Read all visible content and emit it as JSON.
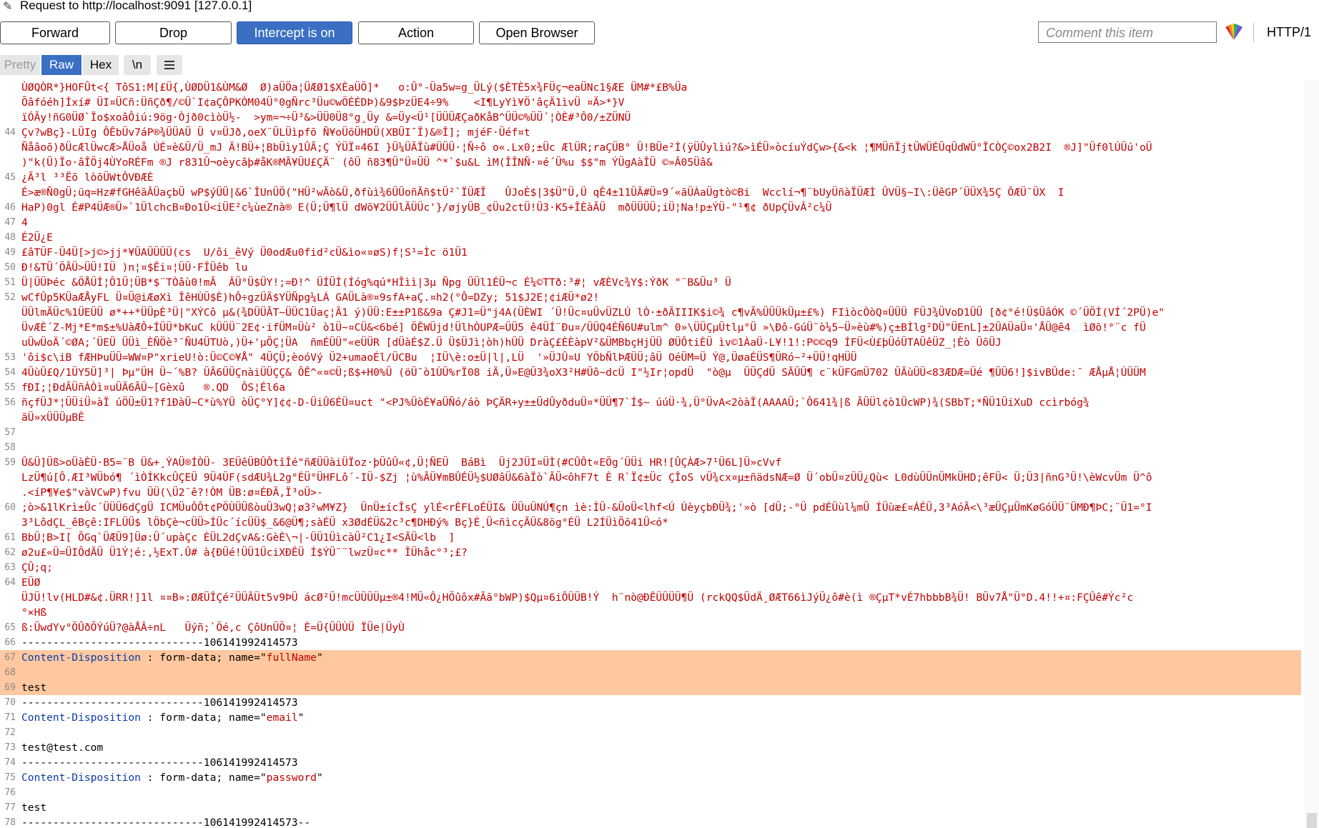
{
  "title": "Request to http://localhost:9091  [127.0.0.1]",
  "toolbar": {
    "forward": "Forward",
    "drop": "Drop",
    "intercept": "Intercept is on",
    "action": "Action",
    "open_browser": "Open Browser",
    "comment_placeholder": "Comment this item",
    "protocol": "HTTP/1",
    "active_color": "#3a6fc4"
  },
  "view": {
    "pretty": "Pretty",
    "raw": "Raw",
    "hex": "Hex",
    "newline": "\\n",
    "menu_icon": "hamburger-icon"
  },
  "body": {
    "lines": [
      {
        "n": "",
        "t": "ÙØQÒR*}HOFÛt<{ TôS1:M[£Ü{,ÙØDÜ1&ÙM&Ø  Ø)aÜÖa¦ÜÆØ1$XÈaÜÖ]*   o:Û°-Üa5w=g_ÜLý($ÈTÈ5x¾FÜç¬eaÜNc1§ÆE ÜM#*£B%Üa"
      },
      {
        "n": "",
        "t": "Õâfóéh]Íxí# ÜI¤ÜCñ:ÜñÇð¶/©Ü`I¢aÇÔPKÒM04Ü°0gÑrc³Üu©wÖÉÉDÞ)&9$ÞzÜE4÷9%    <I¶LyYì¥Ö'âçÄ1ìvÜ ¤Ä>*}V"
      },
      {
        "n": "",
        "t": "ïÓÃy!ñG0ÜØ`Ïo$xoâÔiú:9ög·Òjð0cìòÜ½-  >ym=¬÷Ü³&>ÜÜ0Ü8°g¸Üy &=Üy<Ü¹[ÜÜÜÆÇaðKåB^ÜÜ©%ÜÜ´¦ÒÈ#³Ô0/±ZÜNÜ"
      },
      {
        "n": "44",
        "t": "Çv?wBç}-LÜIg ÔÊbÜv7áP®¾ÜÜAÜ Ü v¤ÜJð,oeX¨ÜLÜìpfõ Ñ¥oÜõÜHDÜ(XBÜI¯Ï)&®Î]; mjéF·Üéf¤t"
      },
      {
        "n": "",
        "t": "Ñåâoõ)ðÜcÆlÜwcÆ>ÅÜoå ÚÉ¤è&Ü/Ü_mJ Ä!BÜ+¦BbÜìy1ÛÃ;Ç ÝÜÏ¤46I }Ü¼ÜÃÏù#ÜÜÜ·¦Ñ÷ô o«.Lx0;±Üc ÆlÜR;raÇÜB° Ü!BÜe²Ì(ÿÜÛylìú?&>ìÉÜ»òcíuÝdÇw>{&<k ¦¶MÜñÏjtÜWÜÉÜqÜdWÜ°ÏCÒÇ©ox2B2I  ®J]\"Üf0lÚÜú'oÜ"
      },
      {
        "n": "",
        "t": ")\"k(Ü)Ïo·âÎÖj4ÙYoRÉFm ®J r831Û¬oèycâþ#åK®MÃ¥ÜU£ÇÄ¨ (ôÜ ñ83¶Ü\"Ü¤ÜÜ ^*`$u&L ìM(ÎÎNÑ·¤é´Ü%u $$\"m ÝÜgAàÎÜ ©»Â05Üâ&"
      },
      {
        "n": "45",
        "t": "¿Ã³l ³³Ëõ lòõÜWtÔVÐÆÈ"
      },
      {
        "n": "",
        "t": "É>æ®Ñ0gÜ;üq=Hz#fGHêãÂÜaçbÜ wP$ýÜÜ|&6`ÎUnÜÖ(\"HÜ²wÃò&Ü,ðfùì¾6ÜÜoñÃñ$tÜ²`ÏÜÆÎ   ÛJoÈ$|3$Ü\"Ü,Ü qÊ4±11ÜÃ#Ü¤9´«ãÜÀaÜgtò©Bi  Wcclí¬¶¨bUyÜñàÏÜÆÌ ÛVÜ§~I\\:ÜêGP´ÜÜX¾5Ç ÔÆÜ¯ÜX  I"
      },
      {
        "n": "46",
        "t": "HaP)0gl É#P4ÜÆ®Ü»`1ÜlchcB¤Ðo1Ü<iÜE²c¼ùeZnà® E(Ü;Ü¶lÜ dWõ¥2ÜÜlÃÜÜc'}/øjyÜB_¢Üu2ctÜ!Ü3·K5+ÎÈàÃÜ  mðÜÜÜÜ;iÜ¦Na!p±ÝÜ-\"¹¶¢ ðUpÇÜvÂ²c¼Ü"
      },
      {
        "n": "47",
        "t": "4"
      },
      {
        "n": "48",
        "t": "É2Ü¿E"
      },
      {
        "n": "49",
        "t": "£âTÜF-Ü4Ü[>j©>jj*¥ÜAÜÜÜÜ(cs  U/ôi_êVý Ü0odÆu0fid²cÜ&ìo«¤øS)f¦S¹=Ìc ö1Ü1"
      },
      {
        "n": "50",
        "t": "Ð!&TÜ´ÖÃÜ>ÜÜ!IÜ )n¦¤$Êi¤¦ÜÜ·FÎÜêb lu"
      },
      {
        "n": "51",
        "t": "Ü|ÜÜÞéc &ÖÅÜÍ¦Ô1Ü¦ÜB*$¨TÒâù0!mÃ  ÂÜ°Ü$ÜY!;=Ð!^ ÜÍÜÍ(Íóg%qú*HÎìì|3µ Ñpg ÜÜl1ÉÜ¬c É¼©TTð:³#¦ vÆÈVc¾Y$:ÝðK \"¨B&Üu³ Ü"
      },
      {
        "n": "52",
        "t": "wCfÛp5KÜaÆÅyFL Ü¤Ü@iÆøXì ÎêHÙÜ$È)hÔ÷gzÜÄ$YÜÑpg¼LÁ GAÜLà®¤9sfA+aÇ.¤h2(°Ô=DZy; 51$J2E¦¢iÆÜ*ø2!"
      },
      {
        "n": "",
        "t": "ÜÜlmÃÜc%1ÜEÜÜ ø*++*ÜÜpÈ³Ü|\"XÝCô µ&(¾DÜÜÃT~ÜÜC1Üaç¦Ã1 ý)ÜÜ:E±±P1ß&9a Ç#J1=Ü\"j4A(ÜÈWI ´Ü!Üc¤uÜvÜZLÚ lÒ·±ðÃIIIK$i©¾ c¶vÃ%ÜÜÜkÜµ±£%) FIìòcÒòQ¤ÜÜÜ FÜJ¾ÜVoD1ÜÜ [ð¢°é!Ü$ÜâÓK ©´ÜÖÍ(VÍ´2PÜ)e\""
      },
      {
        "n": "",
        "t": "ÜvÆÈ´Z-Mj*E*m$±%UàÆÔ+ÍÜÜ*bKuC kÜÜÜ¨2E¢·ifÜM¤Üù² ò1Ü~¤CÜ&<6bé] ÖÊWÜjd!ÜlhÒUPÆ=ÜÜ5 ê4ÜÍ¨Ðu¤/ÜÜQ4ÉÑ6U#ulm^ 0»\\ÜÜÇµÜtlµ°Ü »\\Ðô-GúÜ¯ò¼5~Ü»èù#%)ç±BÌlg²DÜ\"ÜEnL]±2ÜAÜaÜ¤'ÅÜ@ê4  ìØõ!°¨c fÜ"
      },
      {
        "n": "",
        "t": "uÜwÜoÄ´©ØA;´ÜEÜ ÜÜì_ÈÑÖè³¯ÑU4ÜTUò,)Ü+'µÕÇ¦ÜA  ñmÉÜÜ\"«eÜÜR [dÜàÉ$Z.Ü Ü$ÜJì¦òh)hÜÜ DràÇ£ÈÈàpV²&ÜMBbçHjÜÜ ØÜÔtiÈÜ ìv©1ÀaÜ-L¥!1!:P©©q9 ÍFÜ<Ù£þÜóÜTAÜêÜZ_¦Èò ÜõÜJ"
      },
      {
        "n": "53",
        "t": "'ôi$c\\iB fÆHÞuÜÜ=WW¤P\"xrieU!ò:Ü©C©¥Å\" 4ÜÇÜ;èoóVý Ü2+umaoÉl/ÜCBu  ¦IÜ\\è:o±Ü|l|,LÜ  '»ÜJÛ¤U YÖbÑlÞÆÜÜ;âÜ OéÜM=Ü Ý@,ÜøaÉÜS¶ÜRó~²+ÜÜ!qHÜÜ"
      },
      {
        "n": "54",
        "t": "4ÜùÜ£Q/1ÜY5Ü]³| Þµ\"ÜH Ü~´%B? ÜÃ6ÜÜÇnàiÜÜÇÇ& ÔÊ^«¤©Ü;ß$+H0%Ü (öÜ¯ò1ÙÜ%rÏ08 iÃ,Ü»E@Ü3¾oX3²H#Üô~dcÜ I\"½Ir¦opdÜ  \"ò@µ  ÜÜÇdÜ SÃÜÜ¶ c¨kÜFGmÜ702 ÜÃùÜÜ<83ÆDÆ=Üé ¶ÜÜ6!]$ivBÜde:¯ ÆÅµÅ¦ÚÜÜM"
      },
      {
        "n": "55",
        "t": "fÐI;¦ÐdÃÜñÀÒì¤uÜÄ6ÃÜ~[Gèxû   ®.QD  ÔS¦Él6a"
      },
      {
        "n": "56",
        "t": "ñçfÜJ*¦ÜÜiÜ»àÏ úÖÜ±Ü1?f1ÐàÜ~C*ù%YÜ òÜÇ°Y]¢¢-D-ÜiÛ6ÉÜ¤uct \"<PJ%ÜòÉ¥aÜÑó/áò ÞÇÄR+y±±ÜdÛyðduÜ¤*ÜÜ¶7`Í$~ úúÜ·¾,Ü°ÜvA<2òàÏ(AAAAÜ;`Ô641¾|ß ÃÜÜl¢ò1ÜcWP)¾(SBbT;*ÑÜ1ÜiXuD ccìrbóg¾"
      },
      {
        "n": "",
        "t": "ãÜ»xÜÜÜµBÊ"
      },
      {
        "n": "57",
        "t": ""
      },
      {
        "n": "58",
        "t": ""
      },
      {
        "n": "59",
        "t": "Û&Ü]Üß>oÜàÈÜ·B5=¨B Ü&+¸ÝAÜ®ÍÒÜ- 3EÜêÜBÛÔtîÎé\"ñÆÜÜàiÜÏoz·þÜûÛ«¢,Ü¦ÑEÜ  BáBì  Üj2JÜI¤ÜÌ(#CÛÔt«EÕg´ÜÜi HR![ÛÇÀÆ>7¹Ü6L]Ü»cVvf"
      },
      {
        "n": "",
        "t": "LzÜ¶ú[Ô.ÆI³WÜbó¶ ´ìÒÍKkcÛÇEÜ 9Ü4ÜF(sdÆU¾L2g°ÉÜ°ÜHFLô´-IÜ-$Zj ¦ù%ÃÜ¥mBÛÉÜ½$UØâÜ&6àÏò`ÃÜ<ôhF7t È R`Ï¢±Üc ÇÎoS vÜ¾cx¤µ±ñädsNÆ=Ø Ü´obÜ¤zÜÜ¿Qù< L0dùÜÜnÜMkÜHD;êFÜ< Ü;Ü3|ñnG³Ü!\\èWcvÜm Ü^ô"
      },
      {
        "n": "",
        "t": ".<íP¶¥e$\"vàVCwP)fvu ÜÜ(\\Ü2¨ê?!ÒM ÜB:ø¤ÉÐÃ,Ï³oÜ>-"
      },
      {
        "n": "60",
        "t": ";ò>&1lKrì±Ûc´ÜÜÜ6dÇgÜ ICMÜuÔÔt¢PÖÙÜÜßòuÜ3wQ¦ø3²wM¥Z}  ÜnÜ±ícÎsÇ ylÉ<rÈFLoÉÜI& ÜÜuÜNÚ¶çn ìè:ÌÜ-&ÜoÜ<lhf<Ú ÚèyçbÐÜ¾;'»ò [dÜ;-°Ü pdÉÜùl¼mÜ ÍÜùæ£¤ÁÉÜ,3³AóÃ<\\³æÜÇµÜmKøGóÜÜ¨ÜMÐ¶ÞC;¨Ü1=°I"
      },
      {
        "n": "",
        "t": "3³LôdÇL_êBçê:IFLÜÜ$ lÖbÇè¬cÜÜ>ÍÜc´ícÜÜ$_&6@Ü¶;sàÉÜ x3ØdÉÜ&2c³c¶DHÐý% Bç}É¸Ü<ñìcçÃÜ&8ög°ÉÜ L2ÍÜìÕõ41Ü<ó*"
      },
      {
        "n": "61",
        "t": "BbÜ¦B>I[ ÕGq`ÜÆÜ9]Üø:Ü´upàÇc ÈÜL2dÇvA&:GèÈ\\¬|-ÜÜ1ÜìcàÜ²C1¿I<SÃÜ<lb  ]"
      },
      {
        "n": "62",
        "t": "ø2u£«Ü=ÜIÔdÃÜ Ü1Ý¦é:,½ExT.Û# à{ÐÜé!ÜÜ1ÜciXÐÊÜ Í$ÝÜ¨¨lwzÜ¤c** ÎÜhåc°³;£?"
      },
      {
        "n": "63",
        "t": "ÇÛ;q;"
      },
      {
        "n": "64",
        "t": "EÜØ"
      },
      {
        "n": "",
        "t": "ÜJÜ!lv(HLD#&¢.ÜRR!]1l ¤¤B»:ØÆÜÎÇé²ÜÜÃÜt5v9ÞÜ ácØ²Ü!mcÜÜÜÜµ±®4!MÜ«Ô¿HÕûôx#Ãã°bWP)$Qµ¤6iÔÜÜB!Ý  h¨nò@ÐÊÜÜÜÜ¶Ü (rckQQ$ÜdÄ¸ØÆT66ìJýÜ¿ô#è(ì ®ÇµT*vÉ7hbbbB¾Ü! BÜv7Å\"Ü°D.4!!+¤:FÇÛê#Ýc²c"
      },
      {
        "n": "",
        "t": "°×Hß"
      },
      {
        "n": "65",
        "t": "ß:ÜwdYv°ÖÛðÖÝúÜ?@àÅÂ÷nL   Üýñ;`Öé,c ÇôUnÜÖ¤¦ È=Ü{ÜÜÙÜ ÏÜe|ÜyÙ"
      },
      {
        "n": "66",
        "t": "-----------------------------106141992414573",
        "plain": true
      },
      {
        "n": "67",
        "t": "",
        "hdr": {
          "name": "Content-Disposition",
          "rest": " : form-data; name=\"",
          "val": "fullName",
          "end": "\""
        },
        "hl": true
      },
      {
        "n": "68",
        "t": "",
        "hl": true
      },
      {
        "n": "69",
        "t": "test",
        "hl": true
      },
      {
        "n": "70",
        "t": "-----------------------------106141992414573",
        "plain": true
      },
      {
        "n": "71",
        "t": "",
        "hdr": {
          "name": "Content-Disposition",
          "rest": " : form-data; name=\"",
          "val": "email",
          "end": "\""
        }
      },
      {
        "n": "72",
        "t": ""
      },
      {
        "n": "73",
        "t": "test@test.com"
      },
      {
        "n": "74",
        "t": "-----------------------------106141992414573",
        "plain": true
      },
      {
        "n": "75",
        "t": "",
        "hdr": {
          "name": "Content-Disposition",
          "rest": " : form-data; name=\"",
          "val": "password",
          "end": "\""
        }
      },
      {
        "n": "76",
        "t": ""
      },
      {
        "n": "77",
        "t": "test"
      },
      {
        "n": "78",
        "t": "-----------------------------106141992414573--",
        "plain": true
      }
    ]
  }
}
